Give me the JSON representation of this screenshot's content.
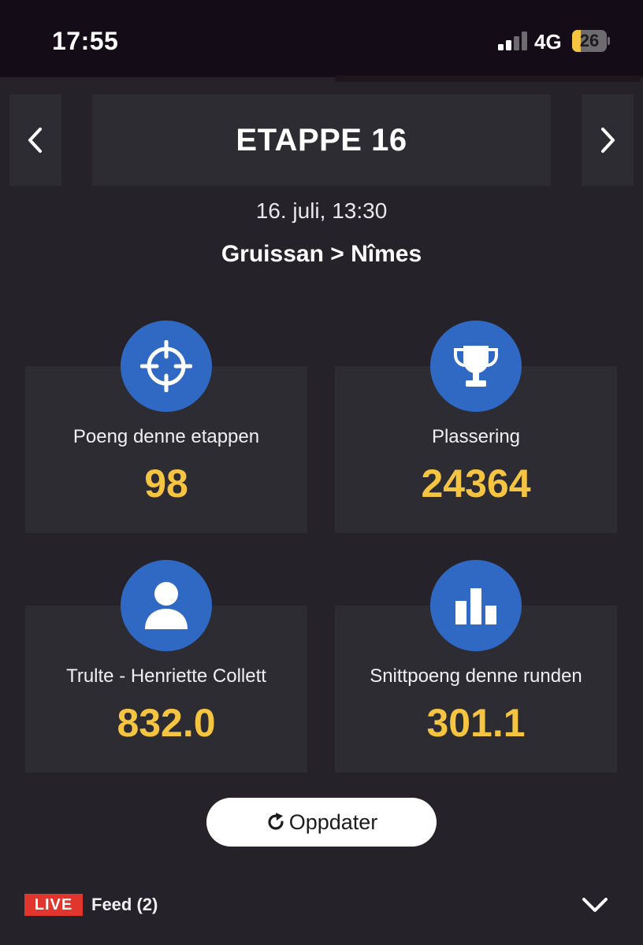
{
  "status_bar": {
    "time": "17:55",
    "network": "4G",
    "battery_level": "26",
    "battery_fraction": 0.26,
    "signal_bars_active": 2,
    "signal_bars_total": 4
  },
  "stage": {
    "title": "ETAPPE 16",
    "date": "16. juli, 13:30",
    "route": "Gruissan > Nîmes"
  },
  "stats": [
    {
      "label": "Poeng denne etappen",
      "value": "98",
      "icon": "crosshair-icon"
    },
    {
      "label": "Plassering",
      "value": "24364",
      "icon": "trophy-icon"
    },
    {
      "label": "Trulte - Henriette Collett",
      "value": "832.0",
      "icon": "user-icon"
    },
    {
      "label": "Snittpoeng denne runden",
      "value": "301.1",
      "icon": "bar-chart-icon"
    }
  ],
  "refresh": {
    "label": "Oppdater",
    "icon": "refresh-icon"
  },
  "feed": {
    "live_label": "LIVE",
    "label": "Feed (2)",
    "toggle_icon": "chevron-down-icon"
  },
  "colors": {
    "background": "#252329",
    "card": "#2e2c33",
    "accent": "#2f69c4",
    "value": "#f5c542",
    "live": "#e0362d"
  }
}
